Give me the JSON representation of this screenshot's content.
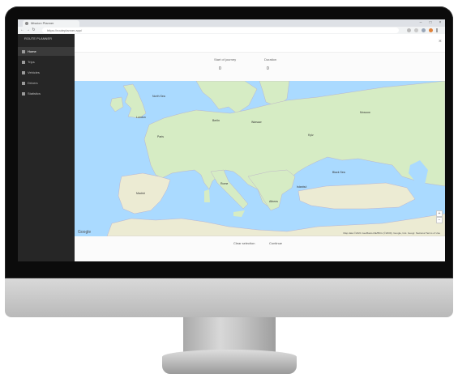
{
  "browser": {
    "tab_title": "Mission Planner",
    "url": "https://routeplanner.app/",
    "window_controls": [
      "minimize-icon",
      "maximize-icon",
      "close-icon"
    ]
  },
  "sidebar": {
    "brand": "ROUTE PLANNER",
    "items": [
      {
        "label": "Home",
        "icon": "home-icon",
        "active": true
      },
      {
        "label": "Trips",
        "icon": "list-icon",
        "active": false
      },
      {
        "label": "Vehicles",
        "icon": "car-icon",
        "active": false
      },
      {
        "label": "Drivers",
        "icon": "user-icon",
        "active": false
      },
      {
        "label": "Statistics",
        "icon": "chart-icon",
        "active": false
      }
    ]
  },
  "main": {
    "fields": [
      {
        "label": "Start of journey",
        "value": "0"
      },
      {
        "label": "Duration",
        "value": "0"
      }
    ],
    "map": {
      "provider_badge": "Google",
      "footer": "Map data ©2021 GeoBasis-DE/BKG (©2009), Google, Inst. Geogr. Nacional  Terms of Use",
      "cities": [
        {
          "name": "North Sea"
        },
        {
          "name": "London"
        },
        {
          "name": "Paris"
        },
        {
          "name": "Berlin"
        },
        {
          "name": "Warsaw"
        },
        {
          "name": "Kyiv"
        },
        {
          "name": "Madrid"
        },
        {
          "name": "Rome"
        },
        {
          "name": "Black Sea"
        },
        {
          "name": "Istanbul"
        },
        {
          "name": "Athens"
        },
        {
          "name": "Moscow"
        }
      ],
      "colors": {
        "water": "#aadaff",
        "land": "#d6ecc4",
        "land_dry": "#ecebd3",
        "border": "#b8a8c8"
      }
    },
    "actions": [
      {
        "label": "Clear selection"
      },
      {
        "label": "Continue"
      }
    ]
  }
}
